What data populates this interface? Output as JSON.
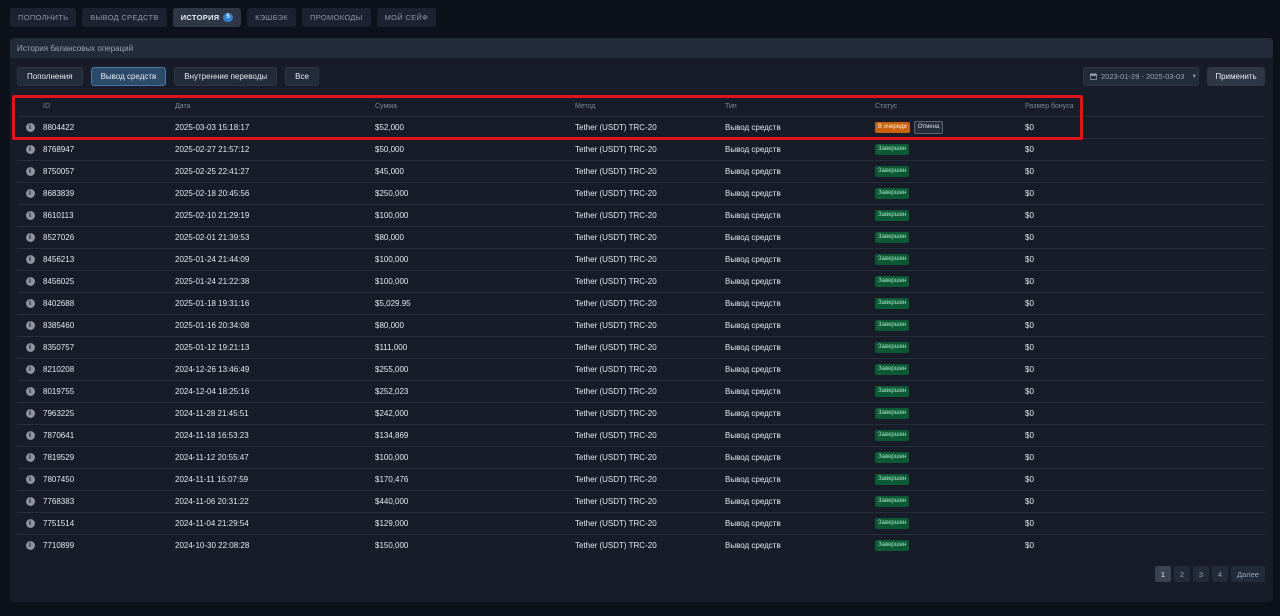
{
  "nav": {
    "tabs": [
      {
        "label": "Пополнить"
      },
      {
        "label": "Вывод средств"
      },
      {
        "label": "История",
        "badge": "5"
      },
      {
        "label": "Кэшбэк"
      },
      {
        "label": "Промокоды"
      },
      {
        "label": "Мой сейф"
      }
    ],
    "active_index": 2
  },
  "panel": {
    "title": "История балансовых операций"
  },
  "filters": {
    "buttons": [
      "Пополнения",
      "Вывод средств",
      "Внутренние переводы",
      "Все"
    ],
    "active_index": 1,
    "date_range": "2023-01-29 - 2025-03-03",
    "apply_label": "Применить"
  },
  "table": {
    "columns": [
      "ID",
      "Дата",
      "Сумма",
      "Метод",
      "Тип",
      "Статус",
      "Размер бонуса"
    ],
    "rows": [
      {
        "id": "8804422",
        "date": "2025-03-03 15:18:17",
        "sum": "$52,000",
        "method": "Tether (USDT) TRC-20",
        "type": "Вывод средств",
        "status": "В очереди",
        "action": "Отмена",
        "bonus": "$0"
      },
      {
        "id": "8768947",
        "date": "2025-02-27 21:57:12",
        "sum": "$50,000",
        "method": "Tether (USDT) TRC-20",
        "type": "Вывод средств",
        "status": "Завершен",
        "bonus": "$0"
      },
      {
        "id": "8750057",
        "date": "2025-02-25 22:41:27",
        "sum": "$45,000",
        "method": "Tether (USDT) TRC-20",
        "type": "Вывод средств",
        "status": "Завершен",
        "bonus": "$0"
      },
      {
        "id": "8683839",
        "date": "2025-02-18 20:45:56",
        "sum": "$250,000",
        "method": "Tether (USDT) TRC-20",
        "type": "Вывод средств",
        "status": "Завершен",
        "bonus": "$0"
      },
      {
        "id": "8610113",
        "date": "2025-02-10 21:29:19",
        "sum": "$100,000",
        "method": "Tether (USDT) TRC-20",
        "type": "Вывод средств",
        "status": "Завершен",
        "bonus": "$0"
      },
      {
        "id": "8527026",
        "date": "2025-02-01 21:39:53",
        "sum": "$80,000",
        "method": "Tether (USDT) TRC-20",
        "type": "Вывод средств",
        "status": "Завершен",
        "bonus": "$0"
      },
      {
        "id": "8456213",
        "date": "2025-01-24 21:44:09",
        "sum": "$100,000",
        "method": "Tether (USDT) TRC-20",
        "type": "Вывод средств",
        "status": "Завершен",
        "bonus": "$0"
      },
      {
        "id": "8456025",
        "date": "2025-01-24 21:22:38",
        "sum": "$100,000",
        "method": "Tether (USDT) TRC-20",
        "type": "Вывод средств",
        "status": "Завершен",
        "bonus": "$0"
      },
      {
        "id": "8402688",
        "date": "2025-01-18 19:31:16",
        "sum": "$5,029.95",
        "method": "Tether (USDT) TRC-20",
        "type": "Вывод средств",
        "status": "Завершен",
        "bonus": "$0"
      },
      {
        "id": "8385460",
        "date": "2025-01-16 20:34:08",
        "sum": "$80,000",
        "method": "Tether (USDT) TRC-20",
        "type": "Вывод средств",
        "status": "Завершен",
        "bonus": "$0"
      },
      {
        "id": "8350757",
        "date": "2025-01-12 19:21:13",
        "sum": "$111,000",
        "method": "Tether (USDT) TRC-20",
        "type": "Вывод средств",
        "status": "Завершен",
        "bonus": "$0"
      },
      {
        "id": "8210208",
        "date": "2024-12-26 13:46:49",
        "sum": "$255,000",
        "method": "Tether (USDT) TRC-20",
        "type": "Вывод средств",
        "status": "Завершен",
        "bonus": "$0"
      },
      {
        "id": "8019755",
        "date": "2024-12-04 18:25:16",
        "sum": "$252,023",
        "method": "Tether (USDT) TRC-20",
        "type": "Вывод средств",
        "status": "Завершен",
        "bonus": "$0"
      },
      {
        "id": "7963225",
        "date": "2024-11-28 21:45:51",
        "sum": "$242,000",
        "method": "Tether (USDT) TRC-20",
        "type": "Вывод средств",
        "status": "Завершен",
        "bonus": "$0"
      },
      {
        "id": "7870641",
        "date": "2024-11-18 16:53:23",
        "sum": "$134,869",
        "method": "Tether (USDT) TRC-20",
        "type": "Вывод средств",
        "status": "Завершен",
        "bonus": "$0"
      },
      {
        "id": "7819529",
        "date": "2024-11-12 20:55:47",
        "sum": "$100,000",
        "method": "Tether (USDT) TRC-20",
        "type": "Вывод средств",
        "status": "Завершен",
        "bonus": "$0"
      },
      {
        "id": "7807450",
        "date": "2024-11-11 15:07:59",
        "sum": "$170,476",
        "method": "Tether (USDT) TRC-20",
        "type": "Вывод средств",
        "status": "Завершен",
        "bonus": "$0"
      },
      {
        "id": "7768383",
        "date": "2024-11-06 20:31:22",
        "sum": "$440,000",
        "method": "Tether (USDT) TRC-20",
        "type": "Вывод средств",
        "status": "Завершен",
        "bonus": "$0"
      },
      {
        "id": "7751514",
        "date": "2024-11-04 21:29:54",
        "sum": "$129,000",
        "method": "Tether (USDT) TRC-20",
        "type": "Вывод средств",
        "status": "Завершен",
        "bonus": "$0"
      },
      {
        "id": "7710899",
        "date": "2024-10-30 22:08:28",
        "sum": "$150,000",
        "method": "Tether (USDT) TRC-20",
        "type": "Вывод средств",
        "status": "Завершен",
        "bonus": "$0"
      }
    ]
  },
  "pagination": {
    "pages": [
      "1",
      "2",
      "3",
      "4"
    ],
    "active_index": 0,
    "next_label": "Далее"
  },
  "icons": {
    "row_info": "info-icon",
    "date_picker": "calendar-icon",
    "date_dropdown": "chevron-down-icon"
  },
  "colors": {
    "status_done": "#0c5a35",
    "status_queue": "#c8620d",
    "highlight": "#e0141b",
    "active_filter": "#2c4a6a"
  }
}
